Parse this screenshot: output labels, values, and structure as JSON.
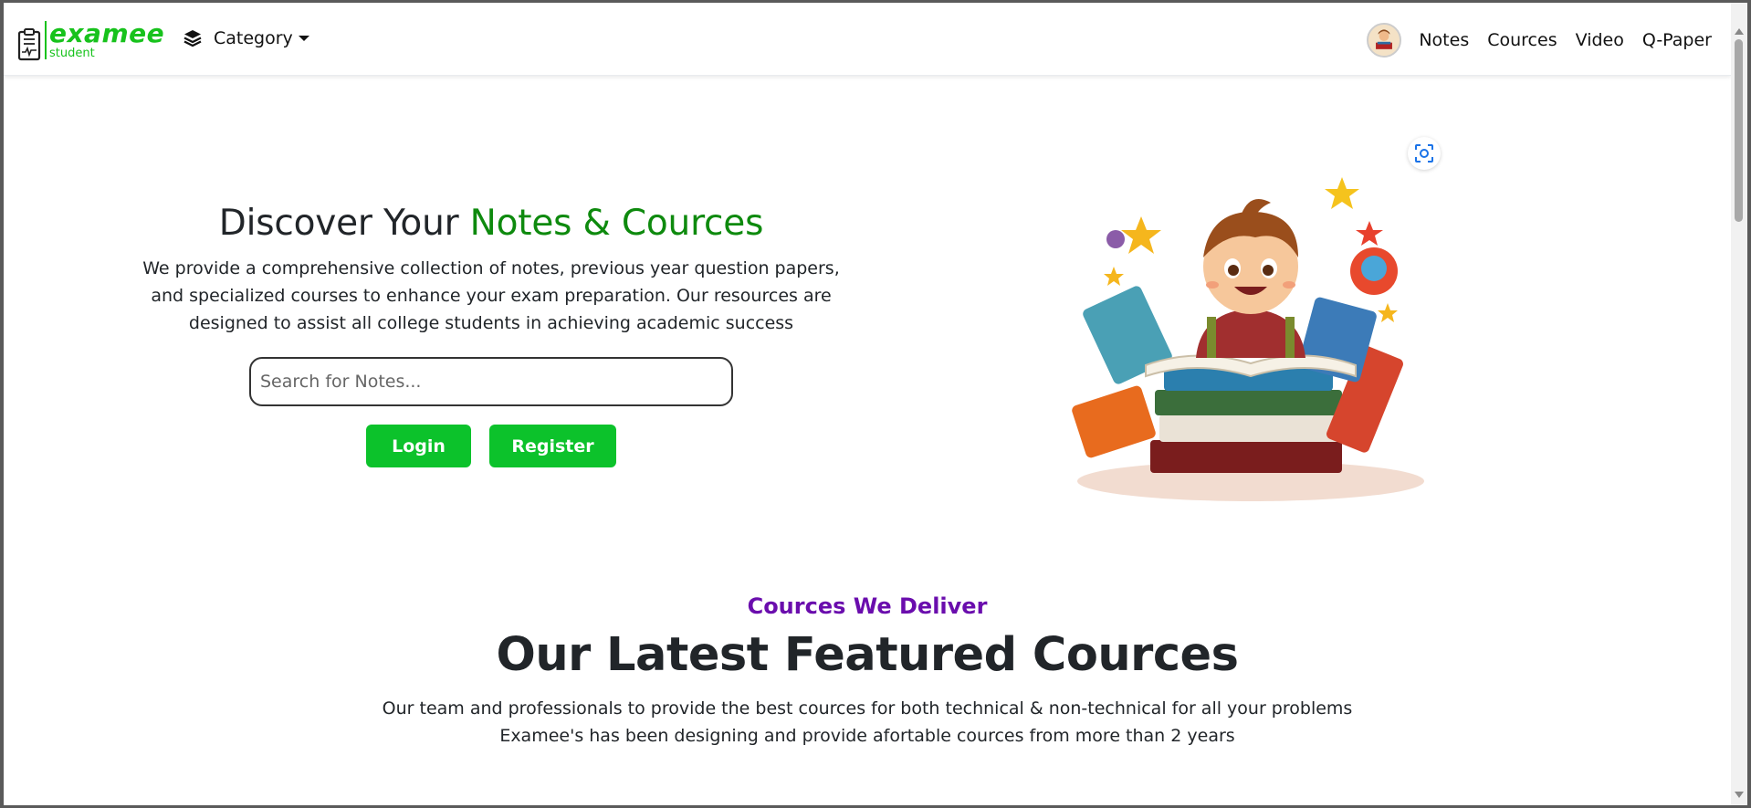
{
  "brand": {
    "name": "examee",
    "sub": "student",
    "color": "#17c21c"
  },
  "nav": {
    "category_label": "Category",
    "links": [
      "Notes",
      "Cources",
      "Video",
      "Q-Paper"
    ]
  },
  "hero": {
    "title_plain": "Discover Your ",
    "title_accent": "Notes & Cources",
    "description": "We provide a comprehensive collection of notes, previous year question papers, and specialized courses to enhance your exam preparation. Our resources are designed to assist all college students in achieving academic success",
    "search_placeholder": "Search for Notes...",
    "login_label": "Login",
    "register_label": "Register",
    "accent_color": "#0e8a0e",
    "button_color": "#0cc22b"
  },
  "courses": {
    "kicker": "Cources We Deliver",
    "title": "Our Latest Featured Cources",
    "desc_line1": "Our team and professionals to provide the best cources for both technical & non-technical for all your problems",
    "desc_line2": "Examee's has been designing and provide afortable cources from more than 2 years",
    "kicker_color": "#6a0dad"
  }
}
